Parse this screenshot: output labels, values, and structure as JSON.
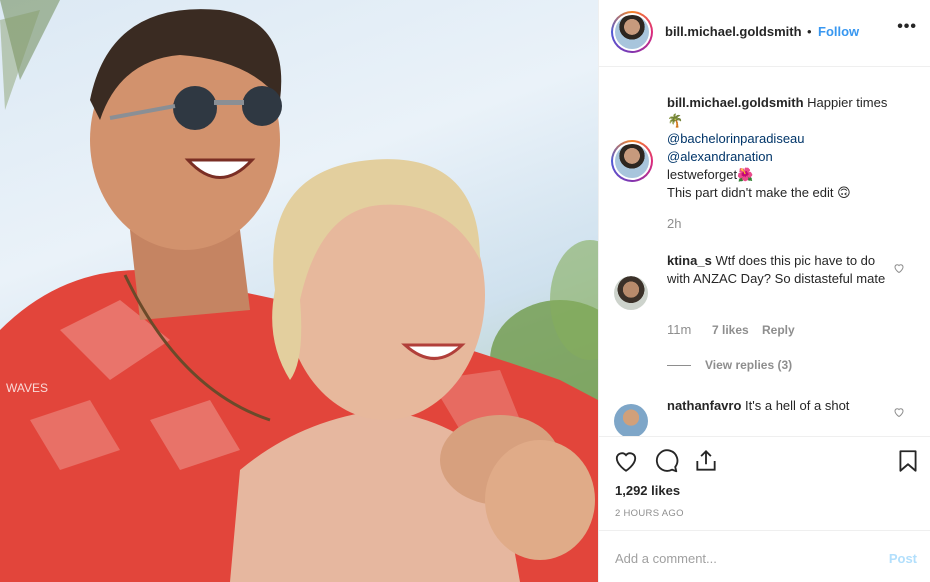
{
  "post": {
    "username": "bill.michael.goldsmith",
    "follow_label": "Follow",
    "dot": "•",
    "more": "•••",
    "photo_shirt_text": "WAVES"
  },
  "caption": {
    "username": "bill.michael.goldsmith",
    "text": "Happier times",
    "emoji_palm": "🌴",
    "mention1": "@bachelorinparadiseau",
    "mention2": "@alexandranation",
    "hashtag": "lestweforget",
    "emoji_flower": "🌺",
    "line2": "This part didn't make the edit 🙃",
    "time": "2h"
  },
  "comments": [
    {
      "username": "ktina_s",
      "text": "Wtf does this pic have to do with ANZAC Day? So distasteful mate",
      "time": "11m",
      "likes": "7 likes",
      "reply": "Reply",
      "view_replies": "View replies (3)"
    },
    {
      "username": "nathanfavro",
      "text": "It's a hell of a shot"
    }
  ],
  "footer": {
    "likes": "1,292 likes",
    "time": "2 HOURS AGO",
    "add_comment_placeholder": "Add a comment...",
    "post_label": "Post"
  },
  "icons": [
    "heart-icon",
    "comment-icon",
    "share-icon",
    "bookmark-icon"
  ],
  "colors": {
    "follow": "#3897f0",
    "link": "#003569",
    "post_disabled": "#b2dffc",
    "muted": "#8e8e8e"
  }
}
